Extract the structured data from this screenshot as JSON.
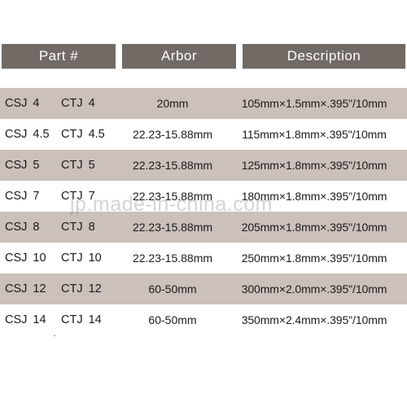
{
  "table": {
    "headers": [
      {
        "key": "part",
        "label": "Part #"
      },
      {
        "key": "arbor",
        "label": "Arbor"
      },
      {
        "key": "desc",
        "label": "Description"
      }
    ],
    "columns": [
      "Part #",
      "Arbor",
      "Description"
    ],
    "rows": [
      {
        "shaded": true,
        "part_code": "CSJ",
        "part_size": "4",
        "arbor_code": "CTJ",
        "arbor_size": "4",
        "bore": "20mm",
        "description": "105mm×1.5mm×.395\"/10mm"
      },
      {
        "shaded": false,
        "part_code": "CSJ",
        "part_size": "4.5",
        "arbor_code": "CTJ",
        "arbor_size": "4.5",
        "bore": "22.23-15.88mm",
        "description": "115mm×1.8mm×.395\"/10mm"
      },
      {
        "shaded": true,
        "part_code": "CSJ",
        "part_size": "5",
        "arbor_code": "CTJ",
        "arbor_size": "5",
        "bore": "22.23-15.88mm",
        "description": "125mm×1.8mm×.395\"/10mm"
      },
      {
        "shaded": false,
        "part_code": "CSJ",
        "part_size": "7",
        "arbor_code": "CTJ",
        "arbor_size": "7",
        "bore": "22.23-15.88mm",
        "description": "180mm×1.8mm×.395\"/10mm"
      },
      {
        "shaded": true,
        "part_code": "CSJ",
        "part_size": "8",
        "arbor_code": "CTJ",
        "arbor_size": "8",
        "bore": "22.23-15.88mm",
        "description": "205mm×1.8mm×.395\"/10mm"
      },
      {
        "shaded": false,
        "part_code": "CSJ",
        "part_size": "10",
        "arbor_code": "CTJ",
        "arbor_size": "10",
        "bore": "22.23-15.88mm",
        "description": "250mm×1.8mm×.395\"/10mm"
      },
      {
        "shaded": true,
        "part_code": "CSJ",
        "part_size": "12",
        "arbor_code": "CTJ",
        "arbor_size": "12",
        "bore": "60-50mm",
        "description": "300mm×2.0mm×.395\"/10mm"
      },
      {
        "shaded": false,
        "part_code": "CSJ",
        "part_size": "14",
        "arbor_code": "CTJ",
        "arbor_size": "14",
        "bore": "60-50mm",
        "description": "350mm×2.4mm×.395\"/10mm"
      }
    ]
  },
  "watermark": {
    "text": "jp.made-in-china.com"
  },
  "colors": {
    "header_bg": "#726a64",
    "header_text": "#ffffff",
    "row_shaded_bg": "#cbc0ba",
    "row_plain_bg": "#ffffff",
    "body_text": "#1a1a1a",
    "divider": "#8c8c8c",
    "page_bg": "#ffffff"
  }
}
